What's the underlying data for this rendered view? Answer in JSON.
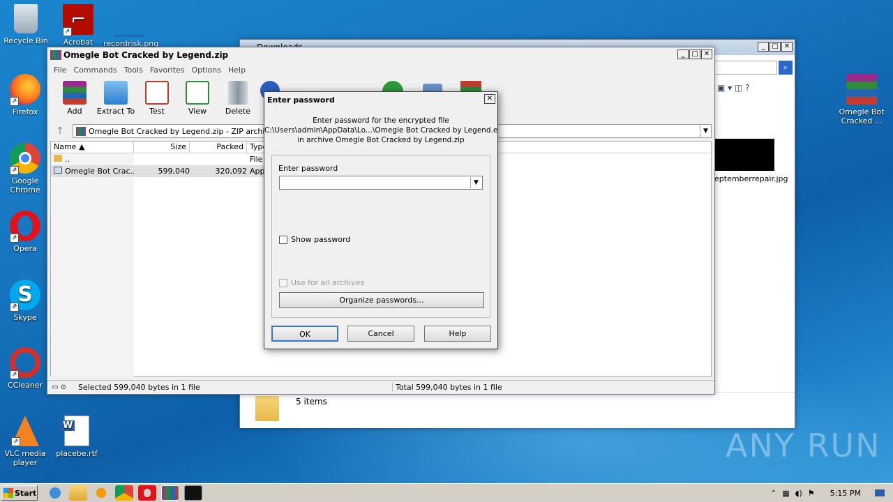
{
  "desktop": {
    "icons": [
      {
        "label": "Recycle Bin",
        "icon": "recycle-bin-icon"
      },
      {
        "label": "Acrobat",
        "icon": "acrobat-icon"
      },
      {
        "label": "recordrisk.png",
        "icon": "image-file-icon"
      },
      {
        "label": "Firefox",
        "icon": "firefox-icon"
      },
      {
        "label": "Google Chrome",
        "icon": "chrome-icon"
      },
      {
        "label": "Opera",
        "icon": "opera-icon"
      },
      {
        "label": "Skype",
        "icon": "skype-icon"
      },
      {
        "label": "CCleaner",
        "icon": "ccleaner-icon"
      },
      {
        "label": "VLC media player",
        "icon": "vlc-icon"
      },
      {
        "label": "placebe.rtf",
        "icon": "word-doc-icon"
      },
      {
        "label": "Omegle Bot Cracked ...",
        "icon": "winrar-archive-icon"
      }
    ],
    "watermark": "ANY RUN"
  },
  "explorer": {
    "title": "Downloads",
    "file_label": "eptemberrepair.jpg",
    "status": "5 items"
  },
  "winrar": {
    "title": "Omegle Bot Cracked by Legend.zip",
    "menu": [
      "File",
      "Commands",
      "Tools",
      "Favorites",
      "Options",
      "Help"
    ],
    "toolbar": [
      "Add",
      "Extract To",
      "Test",
      "View",
      "Delete"
    ],
    "address": "Omegle Bot Cracked by Legend.zip - ZIP archive",
    "columns": [
      "Name",
      "Size",
      "Packed",
      "Type"
    ],
    "rows": [
      {
        "name": "..",
        "size": "",
        "packed": "",
        "type": "File f"
      },
      {
        "name": "Omegle Bot Crac...",
        "size": "599,040",
        "packed": "320,092",
        "type": "Appl"
      }
    ],
    "status_left": "Selected 599,040 bytes in 1 file",
    "status_right": "Total 599,040 bytes in 1 file"
  },
  "dialog": {
    "title": "Enter password",
    "line1": "Enter password for the encrypted file",
    "line2": "C:\\Users\\admin\\AppData\\Lo...\\Omegle Bot Cracked by Legend.exe",
    "line3": "in archive Omegle Bot Cracked by Legend.zip",
    "field_label": "Enter password",
    "password_value": "",
    "show_password": "Show password",
    "use_all": "Use for all archives",
    "organize": "Organize passwords...",
    "ok": "OK",
    "cancel": "Cancel",
    "help": "Help"
  },
  "taskbar": {
    "start": "Start",
    "time": "5:15 PM"
  }
}
